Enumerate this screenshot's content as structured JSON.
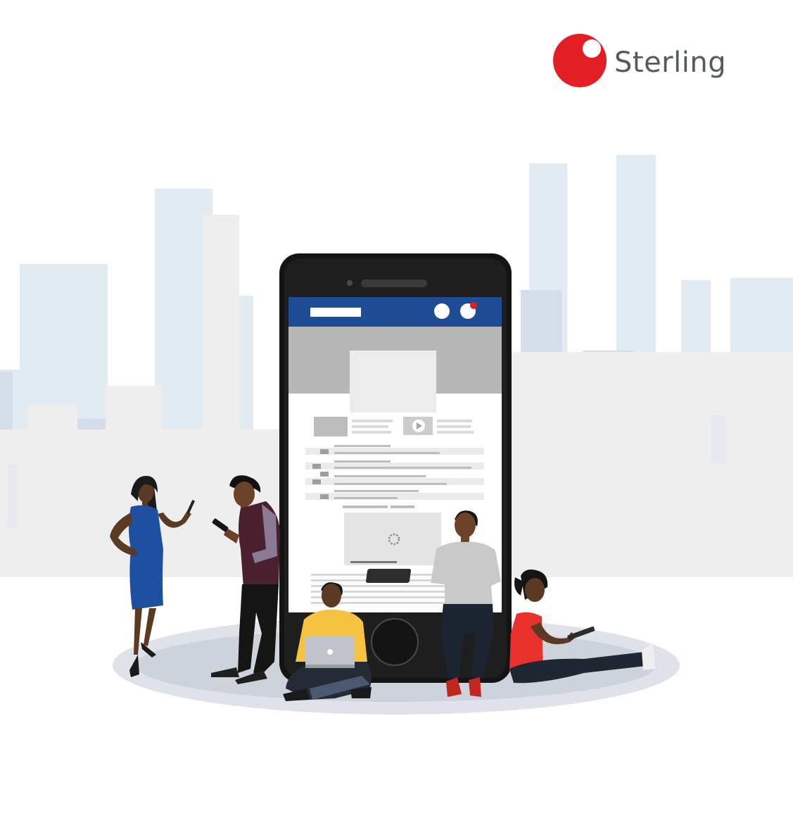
{
  "brand": {
    "name": "Sterling",
    "accent_color": "#e31e24",
    "text_color": "#58595b"
  },
  "illustration": {
    "icons": [
      "city-skyline",
      "smartphone",
      "people-using-devices"
    ],
    "phone_header_color": "#1e4d96"
  }
}
